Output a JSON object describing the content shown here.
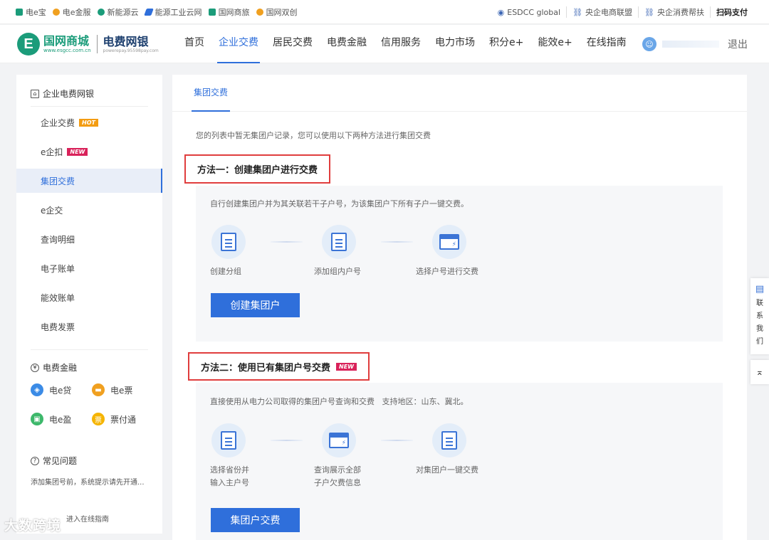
{
  "topbar": {
    "links": [
      {
        "label": "电e宝",
        "icon": "dianebao-icon",
        "color": "#1b9c7a"
      },
      {
        "label": "电e金服",
        "icon": "dianejinfu-icon",
        "color": "#f0a020"
      },
      {
        "label": "新能源云",
        "icon": "xinnengyuanyun-icon",
        "color": "#1b9c7a"
      },
      {
        "label": "能源工业云网",
        "icon": "nengyuan-icon",
        "color": "#2f6fdb"
      },
      {
        "label": "国网商旅",
        "icon": "shanglv-icon",
        "color": "#1b9c7a"
      },
      {
        "label": "国网双创",
        "icon": "shuangchuang-icon",
        "color": "#f0a020"
      }
    ],
    "right_links": [
      {
        "label": "ESDCC global"
      },
      {
        "label": "央企电商联盟"
      },
      {
        "label": "央企消费帮扶"
      }
    ],
    "scan_pay": "扫码支付"
  },
  "header": {
    "logo_name": "国网商城",
    "logo_url": "www.esgcc.com.cn",
    "logo_sub": "电费网银",
    "logo_sub_url": "powerepay.95598pay.com",
    "nav": [
      "首页",
      "企业交费",
      "居民交费",
      "电费金融",
      "信用服务",
      "电力市场",
      "积分e+",
      "能效e+",
      "在线指南"
    ],
    "active_nav": "企业交费",
    "logout": "退出"
  },
  "sidebar": {
    "section1": "企业电费网银",
    "items": [
      {
        "label": "企业交费",
        "badge": "HOT"
      },
      {
        "label": "e企扣",
        "badge": "NEW"
      },
      {
        "label": "集团交费",
        "badge": ""
      },
      {
        "label": "e企交",
        "badge": ""
      },
      {
        "label": "查询明细",
        "badge": ""
      },
      {
        "label": "电子账单",
        "badge": ""
      },
      {
        "label": "能效账单",
        "badge": ""
      },
      {
        "label": "电费发票",
        "badge": ""
      }
    ],
    "section2": "电费金融",
    "finance": [
      {
        "label": "电e贷",
        "color": "#3b8be6"
      },
      {
        "label": "电e票",
        "color": "#f0a020"
      },
      {
        "label": "电e盈",
        "color": "#3db86b"
      },
      {
        "label": "票付通",
        "color": "#f5b400"
      }
    ],
    "section3": "常见问题",
    "faq_text": "添加集团号前，系统提示请先开通...",
    "guide": "进入在线指南"
  },
  "main": {
    "tab": "集团交费",
    "intro": "您的列表中暂无集团户记录，您可以使用以下两种方法进行集团交费",
    "method1": {
      "title": "方法一：创建集团户进行交费",
      "desc": "自行创建集团户并为其关联若干子户号，为该集团户下所有子户一键交费。",
      "steps": [
        "创建分组",
        "添加组内户号",
        "选择户号进行交费"
      ],
      "button": "创建集团户"
    },
    "method2": {
      "title": "方法二：使用已有集团户号交费",
      "badge": "NEW",
      "desc": "直接使用从电力公司取得的集团户号查询和交费   支持地区：山东、冀北。",
      "steps": [
        {
          "l1": "选择省份并",
          "l2": "输入主户号"
        },
        {
          "l1": "查询展示全部",
          "l2": "子户欠费信息"
        },
        {
          "l1": "对集团户一键交费",
          "l2": ""
        }
      ],
      "button": "集团户交费"
    }
  },
  "float": {
    "contact": [
      "联",
      "系",
      "我",
      "们"
    ]
  },
  "watermark": "大数跨境"
}
